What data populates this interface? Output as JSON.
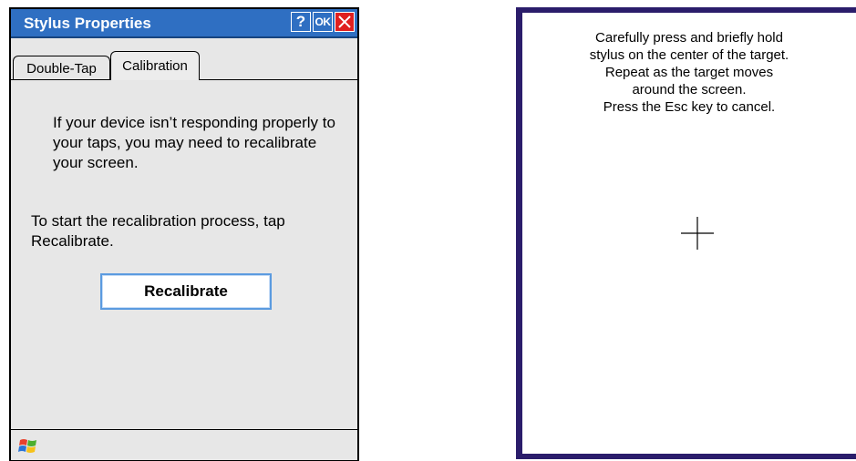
{
  "window": {
    "title": "Stylus Properties",
    "help_label": "?",
    "ok_label": "OK",
    "close_label": "✕"
  },
  "tabs": [
    {
      "label": "Double-Tap",
      "selected": false
    },
    {
      "label": "Calibration",
      "selected": true
    }
  ],
  "calibration_tab": {
    "intro": "If your device isn’t responding properly to your taps, you may need to recalibrate your screen.",
    "instruction": "To start the recalibration process, tap Recalibrate.",
    "button_label": "Recalibrate"
  },
  "taskbar": {
    "start_icon": "windows-logo-icon"
  },
  "calibration_screen": {
    "lines": [
      "Carefully press and briefly hold",
      "stylus on the center of the target.",
      "Repeat as the target moves",
      "around the screen.",
      "Press the Esc key to cancel."
    ],
    "target_icon": "crosshair-icon",
    "border_color": "#2b1d6b"
  },
  "colors": {
    "titlebar": "#2f6fc2",
    "close_button": "#e02020",
    "button_border": "#5b9be0"
  }
}
